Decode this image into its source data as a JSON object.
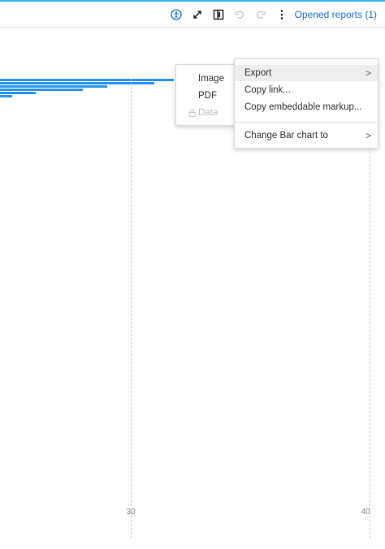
{
  "toolbar": {
    "icons": [
      "accessibility-icon",
      "expand-icon",
      "panel-toggle-icon",
      "undo-icon",
      "redo-icon",
      "more-vertical-icon"
    ],
    "opened_reports": "Opened reports (1)",
    "accent": "#1a73c8"
  },
  "chart": {
    "bar_color": "#2b95f0",
    "tick_labels": [
      "30",
      "40"
    ]
  },
  "menu": {
    "items": [
      {
        "label": "Export",
        "has_submenu": true,
        "active": true
      },
      {
        "label": "Copy link...",
        "has_submenu": false
      },
      {
        "label": "Copy embeddable markup...",
        "has_submenu": false
      },
      {
        "label": "Change Bar chart to",
        "has_submenu": true
      }
    ],
    "chevron": ">"
  },
  "export_submenu": {
    "items": [
      {
        "label": "Image",
        "disabled": false
      },
      {
        "label": "PDF",
        "disabled": false
      },
      {
        "label": "Data",
        "disabled": true
      }
    ]
  }
}
